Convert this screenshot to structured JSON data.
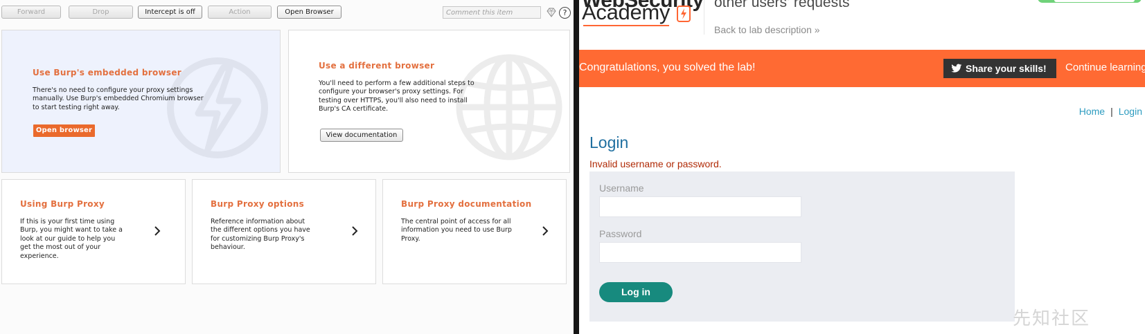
{
  "burp": {
    "toolbar": {
      "forward": "Forward",
      "drop": "Drop",
      "intercept": "Intercept is off",
      "action": "Action",
      "open_browser": "Open Browser",
      "comment_placeholder": "Comment this item",
      "help": "?"
    },
    "cards": {
      "embedded": {
        "title": "Use Burp's embedded browser",
        "text": "There's no need to configure your proxy settings manually. Use Burp's embedded Chromium browser to start testing right away.",
        "button": "Open browser",
        "icon": "lightning-icon"
      },
      "different": {
        "title": "Use a different browser",
        "text": "You'll need to perform a few additional steps to configure your browser's proxy settings. For testing over HTTPS, you'll also need to install Burp's CA certificate.",
        "button": "View documentation",
        "icon": "globe-icon"
      },
      "using": {
        "title": "Using Burp Proxy",
        "text": "If this is your first time using Burp, you might want to take a look at our guide to help you get the most out of your experience."
      },
      "options": {
        "title": "Burp Proxy options",
        "text": "Reference information about the different options you have for customizing Burp Proxy's behaviour."
      },
      "docs": {
        "title": "Burp Proxy documentation",
        "text": "The central point of access for all information you need to use Burp Proxy."
      }
    },
    "colors": {
      "accent": "#e3703f",
      "card_highlight": "#eef2fd"
    }
  },
  "browser": {
    "logo": {
      "top": "WebSecurity",
      "bottom": "Academy"
    },
    "lab_title": "other users' requests",
    "back_link": "Back to lab description »",
    "banner": {
      "message": "Congratulations, you solved the lab!",
      "share": "Share your skills!",
      "continue": "Continue learning"
    },
    "nav": {
      "home": "Home",
      "separator": "|",
      "login": "Login"
    },
    "login": {
      "heading": "Login",
      "error": "Invalid username or password.",
      "username_label": "Username",
      "password_label": "Password",
      "submit": "Log in"
    },
    "watermark": "先知社区",
    "colors": {
      "banner": "#ff6a33",
      "button": "#178a7e",
      "link": "#2e9cc0",
      "heading": "#1f6fa0",
      "error": "#b02a06"
    }
  }
}
